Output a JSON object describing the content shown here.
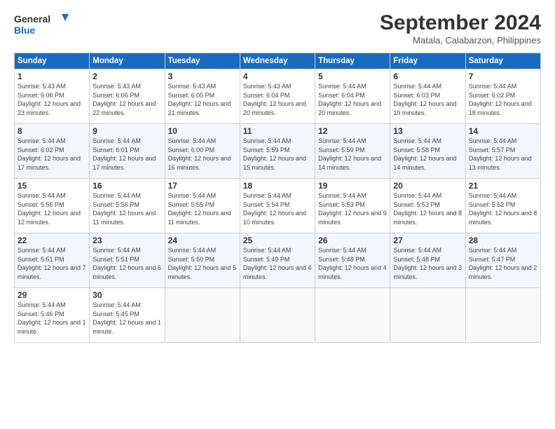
{
  "logo": {
    "line1": "General",
    "line2": "Blue"
  },
  "title": "September 2024",
  "location": "Matala, Calabarzon, Philippines",
  "days_of_week": [
    "Sunday",
    "Monday",
    "Tuesday",
    "Wednesday",
    "Thursday",
    "Friday",
    "Saturday"
  ],
  "weeks": [
    [
      {
        "day": "1",
        "sunrise": "5:43 AM",
        "sunset": "6:06 PM",
        "daylight": "12 hours and 23 minutes."
      },
      {
        "day": "2",
        "sunrise": "5:43 AM",
        "sunset": "6:06 PM",
        "daylight": "12 hours and 22 minutes."
      },
      {
        "day": "3",
        "sunrise": "5:43 AM",
        "sunset": "6:05 PM",
        "daylight": "12 hours and 21 minutes."
      },
      {
        "day": "4",
        "sunrise": "5:43 AM",
        "sunset": "6:04 PM",
        "daylight": "12 hours and 20 minutes."
      },
      {
        "day": "5",
        "sunrise": "5:44 AM",
        "sunset": "6:04 PM",
        "daylight": "12 hours and 20 minutes."
      },
      {
        "day": "6",
        "sunrise": "5:44 AM",
        "sunset": "6:03 PM",
        "daylight": "12 hours and 19 minutes."
      },
      {
        "day": "7",
        "sunrise": "5:44 AM",
        "sunset": "6:02 PM",
        "daylight": "12 hours and 18 minutes."
      }
    ],
    [
      {
        "day": "8",
        "sunrise": "5:44 AM",
        "sunset": "6:02 PM",
        "daylight": "12 hours and 17 minutes."
      },
      {
        "day": "9",
        "sunrise": "5:44 AM",
        "sunset": "6:01 PM",
        "daylight": "12 hours and 17 minutes."
      },
      {
        "day": "10",
        "sunrise": "5:44 AM",
        "sunset": "6:00 PM",
        "daylight": "12 hours and 16 minutes."
      },
      {
        "day": "11",
        "sunrise": "5:44 AM",
        "sunset": "5:59 PM",
        "daylight": "12 hours and 15 minutes."
      },
      {
        "day": "12",
        "sunrise": "5:44 AM",
        "sunset": "5:59 PM",
        "daylight": "12 hours and 14 minutes."
      },
      {
        "day": "13",
        "sunrise": "5:44 AM",
        "sunset": "5:58 PM",
        "daylight": "12 hours and 14 minutes."
      },
      {
        "day": "14",
        "sunrise": "5:44 AM",
        "sunset": "5:57 PM",
        "daylight": "12 hours and 13 minutes."
      }
    ],
    [
      {
        "day": "15",
        "sunrise": "5:44 AM",
        "sunset": "5:56 PM",
        "daylight": "12 hours and 12 minutes."
      },
      {
        "day": "16",
        "sunrise": "5:44 AM",
        "sunset": "5:56 PM",
        "daylight": "12 hours and 11 minutes."
      },
      {
        "day": "17",
        "sunrise": "5:44 AM",
        "sunset": "5:55 PM",
        "daylight": "12 hours and 11 minutes."
      },
      {
        "day": "18",
        "sunrise": "5:44 AM",
        "sunset": "5:54 PM",
        "daylight": "12 hours and 10 minutes."
      },
      {
        "day": "19",
        "sunrise": "5:44 AM",
        "sunset": "5:53 PM",
        "daylight": "12 hours and 9 minutes."
      },
      {
        "day": "20",
        "sunrise": "5:44 AM",
        "sunset": "5:53 PM",
        "daylight": "12 hours and 8 minutes."
      },
      {
        "day": "21",
        "sunrise": "5:44 AM",
        "sunset": "5:52 PM",
        "daylight": "12 hours and 8 minutes."
      }
    ],
    [
      {
        "day": "22",
        "sunrise": "5:44 AM",
        "sunset": "5:51 PM",
        "daylight": "12 hours and 7 minutes."
      },
      {
        "day": "23",
        "sunrise": "5:44 AM",
        "sunset": "5:51 PM",
        "daylight": "12 hours and 6 minutes."
      },
      {
        "day": "24",
        "sunrise": "5:44 AM",
        "sunset": "5:50 PM",
        "daylight": "12 hours and 5 minutes."
      },
      {
        "day": "25",
        "sunrise": "5:44 AM",
        "sunset": "5:49 PM",
        "daylight": "12 hours and 4 minutes."
      },
      {
        "day": "26",
        "sunrise": "5:44 AM",
        "sunset": "5:48 PM",
        "daylight": "12 hours and 4 minutes."
      },
      {
        "day": "27",
        "sunrise": "5:44 AM",
        "sunset": "5:48 PM",
        "daylight": "12 hours and 3 minutes."
      },
      {
        "day": "28",
        "sunrise": "5:44 AM",
        "sunset": "5:47 PM",
        "daylight": "12 hours and 2 minutes."
      }
    ],
    [
      {
        "day": "29",
        "sunrise": "5:44 AM",
        "sunset": "5:46 PM",
        "daylight": "12 hours and 1 minute."
      },
      {
        "day": "30",
        "sunrise": "5:44 AM",
        "sunset": "5:45 PM",
        "daylight": "12 hours and 1 minute."
      },
      null,
      null,
      null,
      null,
      null
    ]
  ]
}
